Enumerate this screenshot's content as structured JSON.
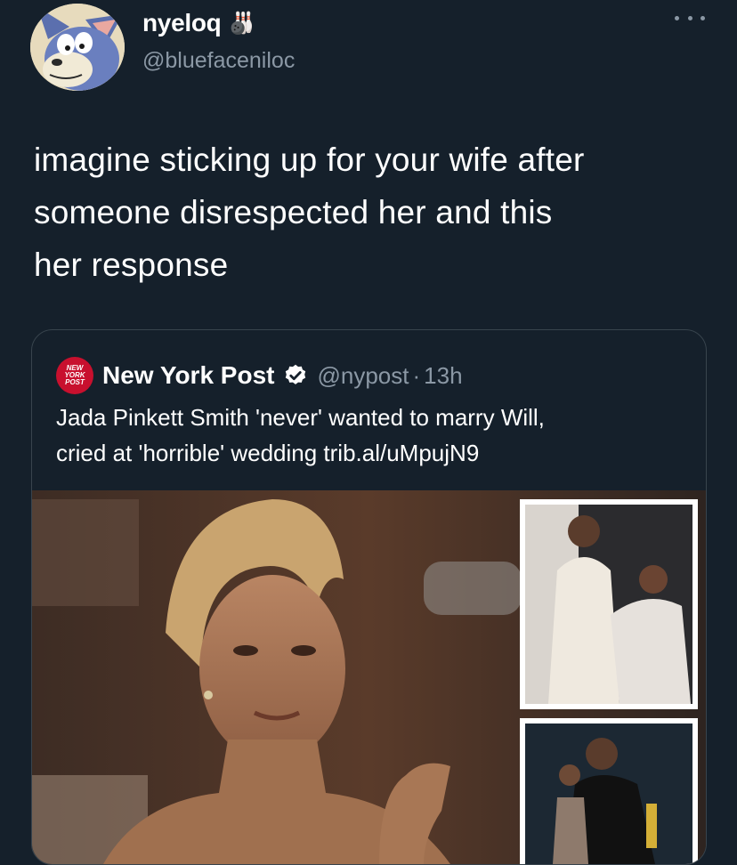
{
  "tweet": {
    "display_name": "nyeloq",
    "name_emoji": "🎳",
    "handle": "@bluefaceniloc",
    "avatar_icon": "cartoon-cat-avatar",
    "text": "imagine sticking up for your wife after\nsomeone disrespected her and this\nher response"
  },
  "quoted_tweet": {
    "logo_lines": [
      "NEW",
      "YORK",
      "POST"
    ],
    "display_name": "New York Post",
    "verified_icon": "verified-badge-icon",
    "handle": "@nypost",
    "separator": "·",
    "timestamp": "13h",
    "text": "Jada Pinkett Smith 'never' wanted to marry Will,\ncried at 'horrible' wedding trib.al/uMpujN9"
  },
  "colors": {
    "background": "#15202b",
    "text_primary": "#ffffff",
    "text_secondary": "#8b98a5",
    "card_border": "#38444d",
    "nypost_red": "#c8102e"
  }
}
